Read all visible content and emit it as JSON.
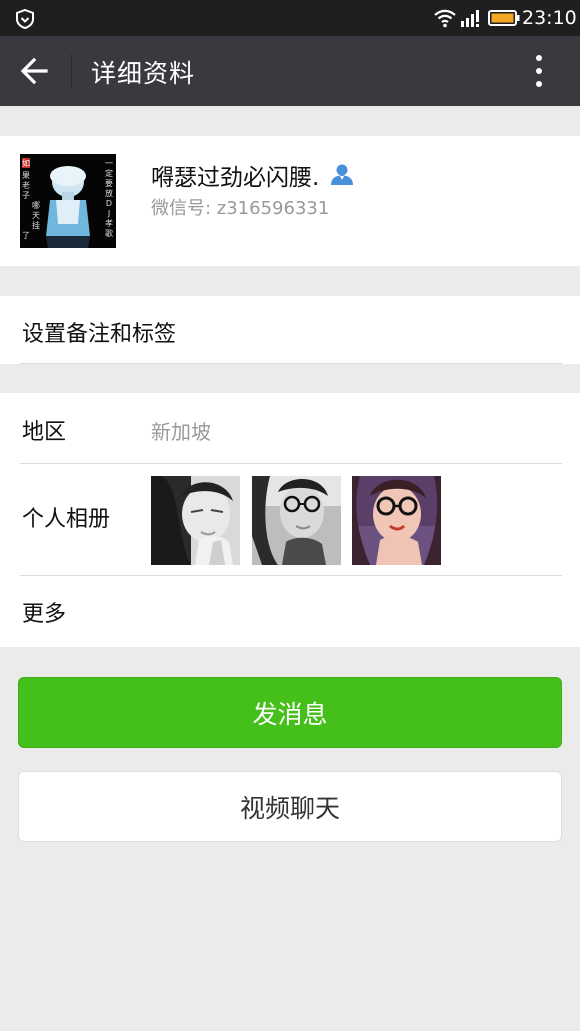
{
  "status_bar": {
    "time": "23:10",
    "icons": [
      "shield-icon",
      "wifi-icon",
      "signal-icon",
      "battery-icon"
    ],
    "battery_color": "#f5a623"
  },
  "toolbar": {
    "title": "详细资料",
    "back_icon": "arrow-left-icon",
    "more_icon": "more-vertical-icon"
  },
  "profile": {
    "nickname": "嘚瑟过劲必闪腰.",
    "wechat_id": "微信号: z316596331",
    "avatar_text_left": "如果老子哪天挂了",
    "avatar_text_right": "一定要放DJ孝歌",
    "contact_icon": "person-icon",
    "contact_icon_color": "#4a90d9"
  },
  "remark": {
    "label": "设置备注和标签"
  },
  "info": {
    "region_label": "地区",
    "region_value": "新加坡",
    "album_label": "个人相册",
    "more_label": "更多",
    "album_photos": [
      "photo-1",
      "photo-2",
      "photo-3"
    ]
  },
  "actions": {
    "send_message": "发消息",
    "video_chat": "视频聊天"
  },
  "colors": {
    "primary_green": "#45c01a",
    "toolbar_bg": "#393a3f",
    "statusbar_bg": "#1f1f1f",
    "page_bg": "#ebebeb"
  }
}
